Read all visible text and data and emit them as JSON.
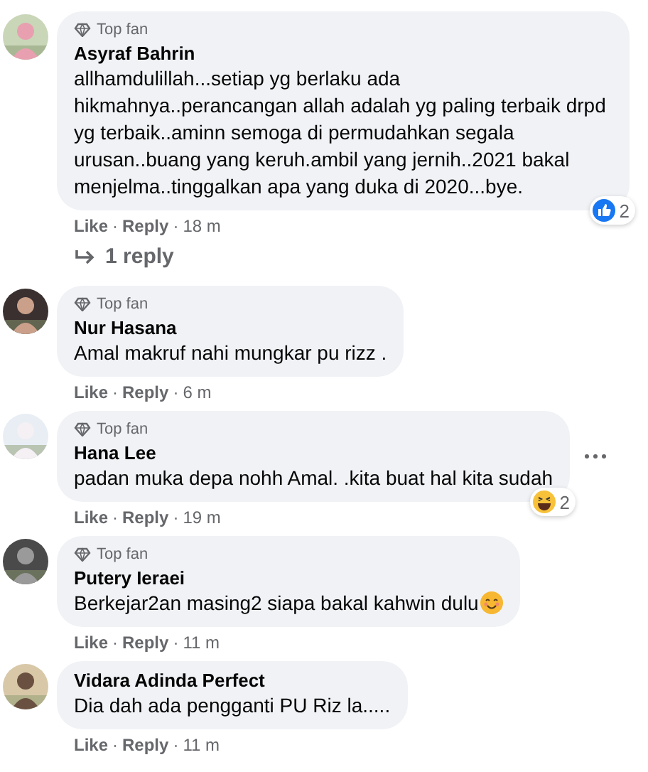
{
  "comments": [
    {
      "top_fan": true,
      "badge": "Top fan",
      "name": "Asyraf Bahrin",
      "text": "allhamdulillah...setiap yg berlaku ada hikmahnya..perancangan allah adalah yg paling terbaik drpd yg terbaik..aminn semoga di permudahkan segala urusan..buang yang keruh.ambil yang jernih..2021 bakal menjelma..tinggalkan apa yang duka di 2020...bye.",
      "reaction": {
        "kind": "like",
        "count": "2"
      },
      "like": "Like",
      "separator": "·",
      "reply": "Reply",
      "time": "18 m",
      "replies": "1 reply",
      "more": false
    },
    {
      "top_fan": true,
      "badge": "Top fan",
      "name": "Nur Hasana",
      "text": "Amal makruf nahi mungkar pu rizz .",
      "like": "Like",
      "separator": "·",
      "reply": "Reply",
      "time": "6 m",
      "more": false
    },
    {
      "top_fan": true,
      "badge": "Top fan",
      "name": "Hana Lee",
      "text": "padan muka depa nohh Amal. .kita buat hal kita sudah",
      "reaction": {
        "kind": "haha",
        "count": "2"
      },
      "like": "Like",
      "separator": "·",
      "reply": "Reply",
      "time": "19 m",
      "more": true
    },
    {
      "top_fan": true,
      "badge": "Top fan",
      "name": "Putery Ieraei",
      "text": "Berkejar2an masing2 siapa bakal kahwin dulu",
      "trailing_icon": {
        "kind": "smile"
      },
      "like": "Like",
      "separator": "·",
      "reply": "Reply",
      "time": "11 m",
      "more": false
    },
    {
      "top_fan": false,
      "name": "Vidara Adinda Perfect",
      "text": "Dia dah ada pengganti PU Riz la.....",
      "like": "Like",
      "separator": "·",
      "reply": "Reply",
      "time": "11 m",
      "more": false
    }
  ]
}
